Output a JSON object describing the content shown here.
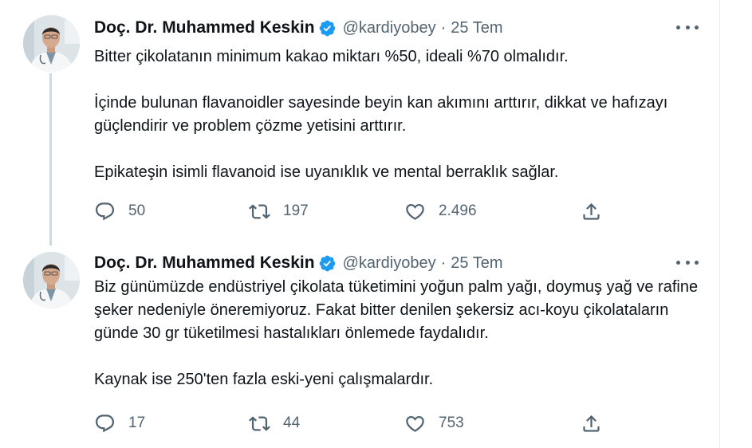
{
  "colors": {
    "text": "#0f1419",
    "secondary": "#536471",
    "verified": "#1d9bf0",
    "thread_line": "#cfd9de",
    "divider": "#e6ecf0"
  },
  "tweets": [
    {
      "author_name": "Doç. Dr. Muhammed Keskin",
      "handle": "@kardiyobey",
      "separator": "·",
      "date": "25 Tem",
      "paragraphs": [
        "Bitter çikolatanın minimum kakao miktarı %50, ideali %70 olmalıdır.",
        "İçinde bulunan flavanoidler sayesinde beyin kan akımını arttırır, dikkat ve hafızayı güçlendirir ve problem çözme yetisini arttırır.",
        "Epikateşin isimli flavanoid ise uyanıklık ve mental berraklık sağlar."
      ],
      "replies": "50",
      "retweets": "197",
      "likes": "2.496"
    },
    {
      "author_name": "Doç. Dr. Muhammed Keskin",
      "handle": "@kardiyobey",
      "separator": "·",
      "date": "25 Tem",
      "paragraphs": [
        "Biz günümüzde endüstriyel çikolata tüketimini yoğun palm yağı, doymuş yağ ve rafine şeker nedeniyle öneremiyoruz. Fakat bitter denilen şekersiz acı-koyu çikolataların günde 30 gr tüketilmesi hastalıkları önlemede faydalıdır.",
        "Kaynak ise 250'ten fazla eski-yeni çalışmalardır."
      ],
      "replies": "17",
      "retweets": "44",
      "likes": "753"
    }
  ],
  "icons": {
    "reply": "reply-icon",
    "retweet": "retweet-icon",
    "like": "heart-icon",
    "share": "share-icon",
    "verified": "verified-badge-icon",
    "more": "more-options-icon"
  }
}
